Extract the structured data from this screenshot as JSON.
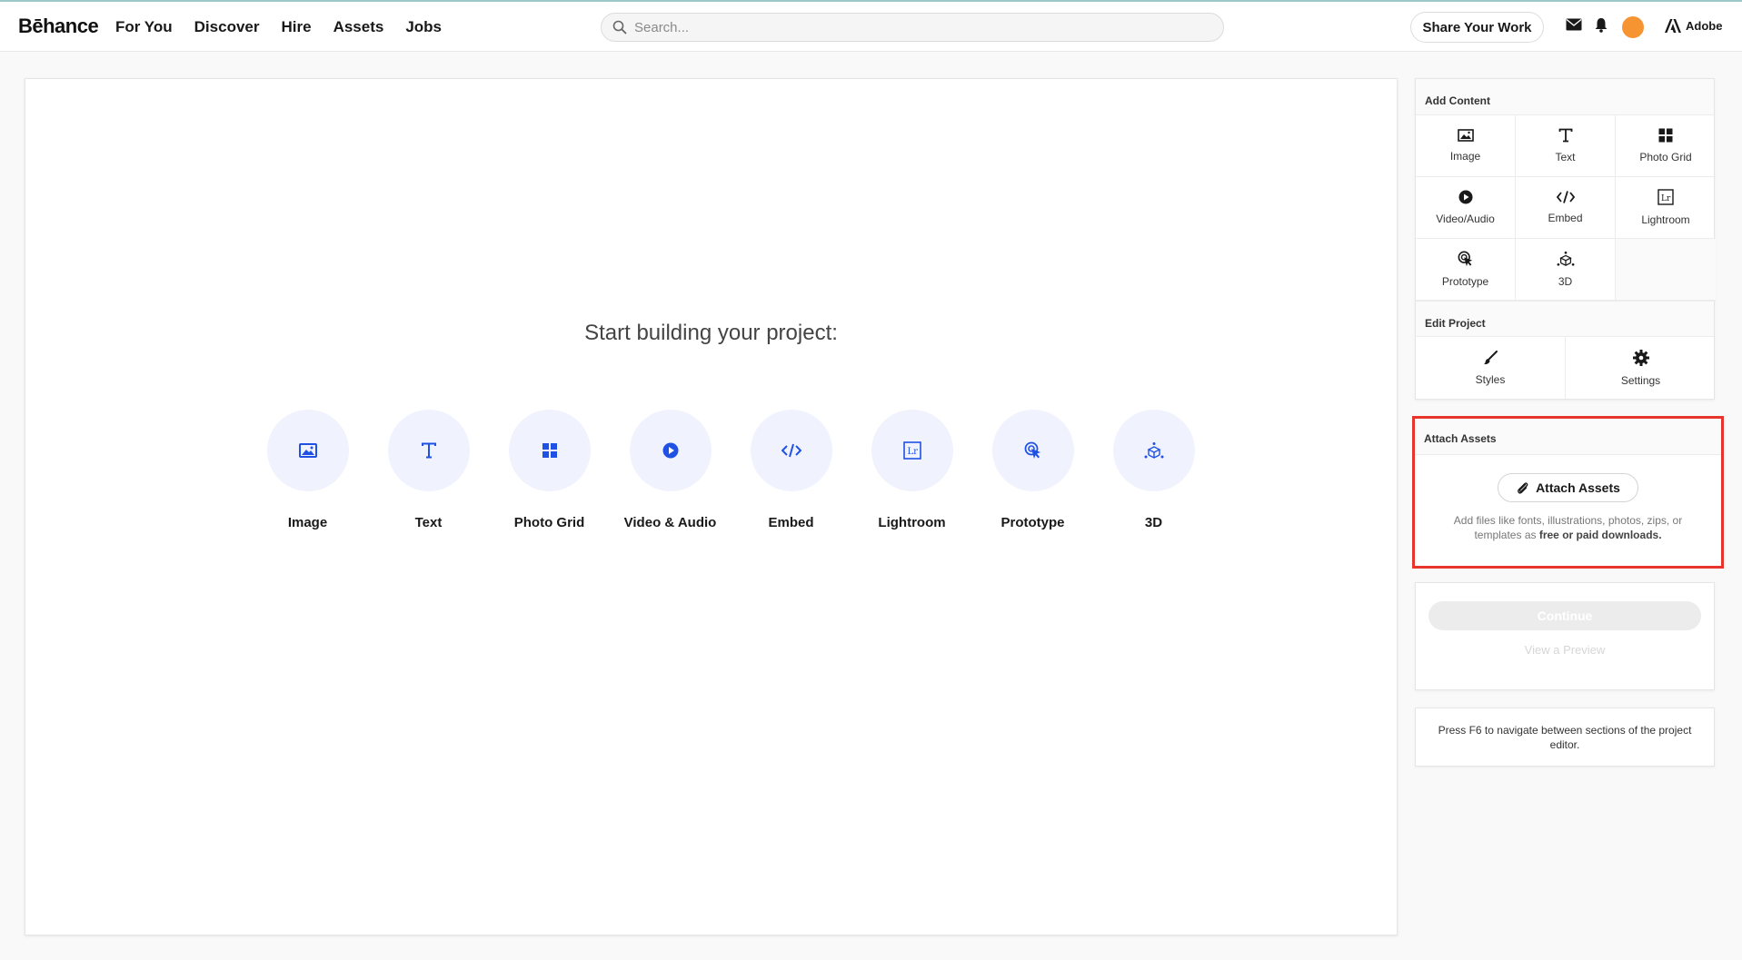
{
  "header": {
    "logo": "Bēhance",
    "nav": [
      "For You",
      "Discover",
      "Hire",
      "Assets",
      "Jobs"
    ],
    "search_placeholder": "Search...",
    "share_label": "Share Your Work",
    "adobe_label": "Adobe",
    "avatar_color": "#f79432"
  },
  "canvas": {
    "title": "Start building your project:",
    "tiles": [
      {
        "label": "Image",
        "icon": "image-icon"
      },
      {
        "label": "Text",
        "icon": "text-icon"
      },
      {
        "label": "Photo Grid",
        "icon": "photo-grid-icon"
      },
      {
        "label": "Video & Audio",
        "icon": "play-icon"
      },
      {
        "label": "Embed",
        "icon": "embed-icon"
      },
      {
        "label": "Lightroom",
        "icon": "lightroom-icon"
      },
      {
        "label": "Prototype",
        "icon": "prototype-icon"
      },
      {
        "label": "3D",
        "icon": "3d-icon"
      }
    ],
    "accent_color": "#1f51e5"
  },
  "sidebar": {
    "add_content_title": "Add Content",
    "add_content": [
      "Image",
      "Text",
      "Photo Grid",
      "Video/Audio",
      "Embed",
      "Lightroom",
      "Prototype",
      "3D"
    ],
    "edit_project_title": "Edit Project",
    "edit_project": [
      "Styles",
      "Settings"
    ],
    "attach_title": "Attach Assets",
    "attach_button": "Attach Assets",
    "attach_text": "Add files like fonts, illustrations, photos, zips, or templates as",
    "attach_text_bold": "free or paid downloads.",
    "continue_label": "Continue",
    "preview_label": "View a Preview",
    "f6_note": "Press F6 to navigate between sections of the project editor.",
    "highlight_color": "#e8352c"
  }
}
